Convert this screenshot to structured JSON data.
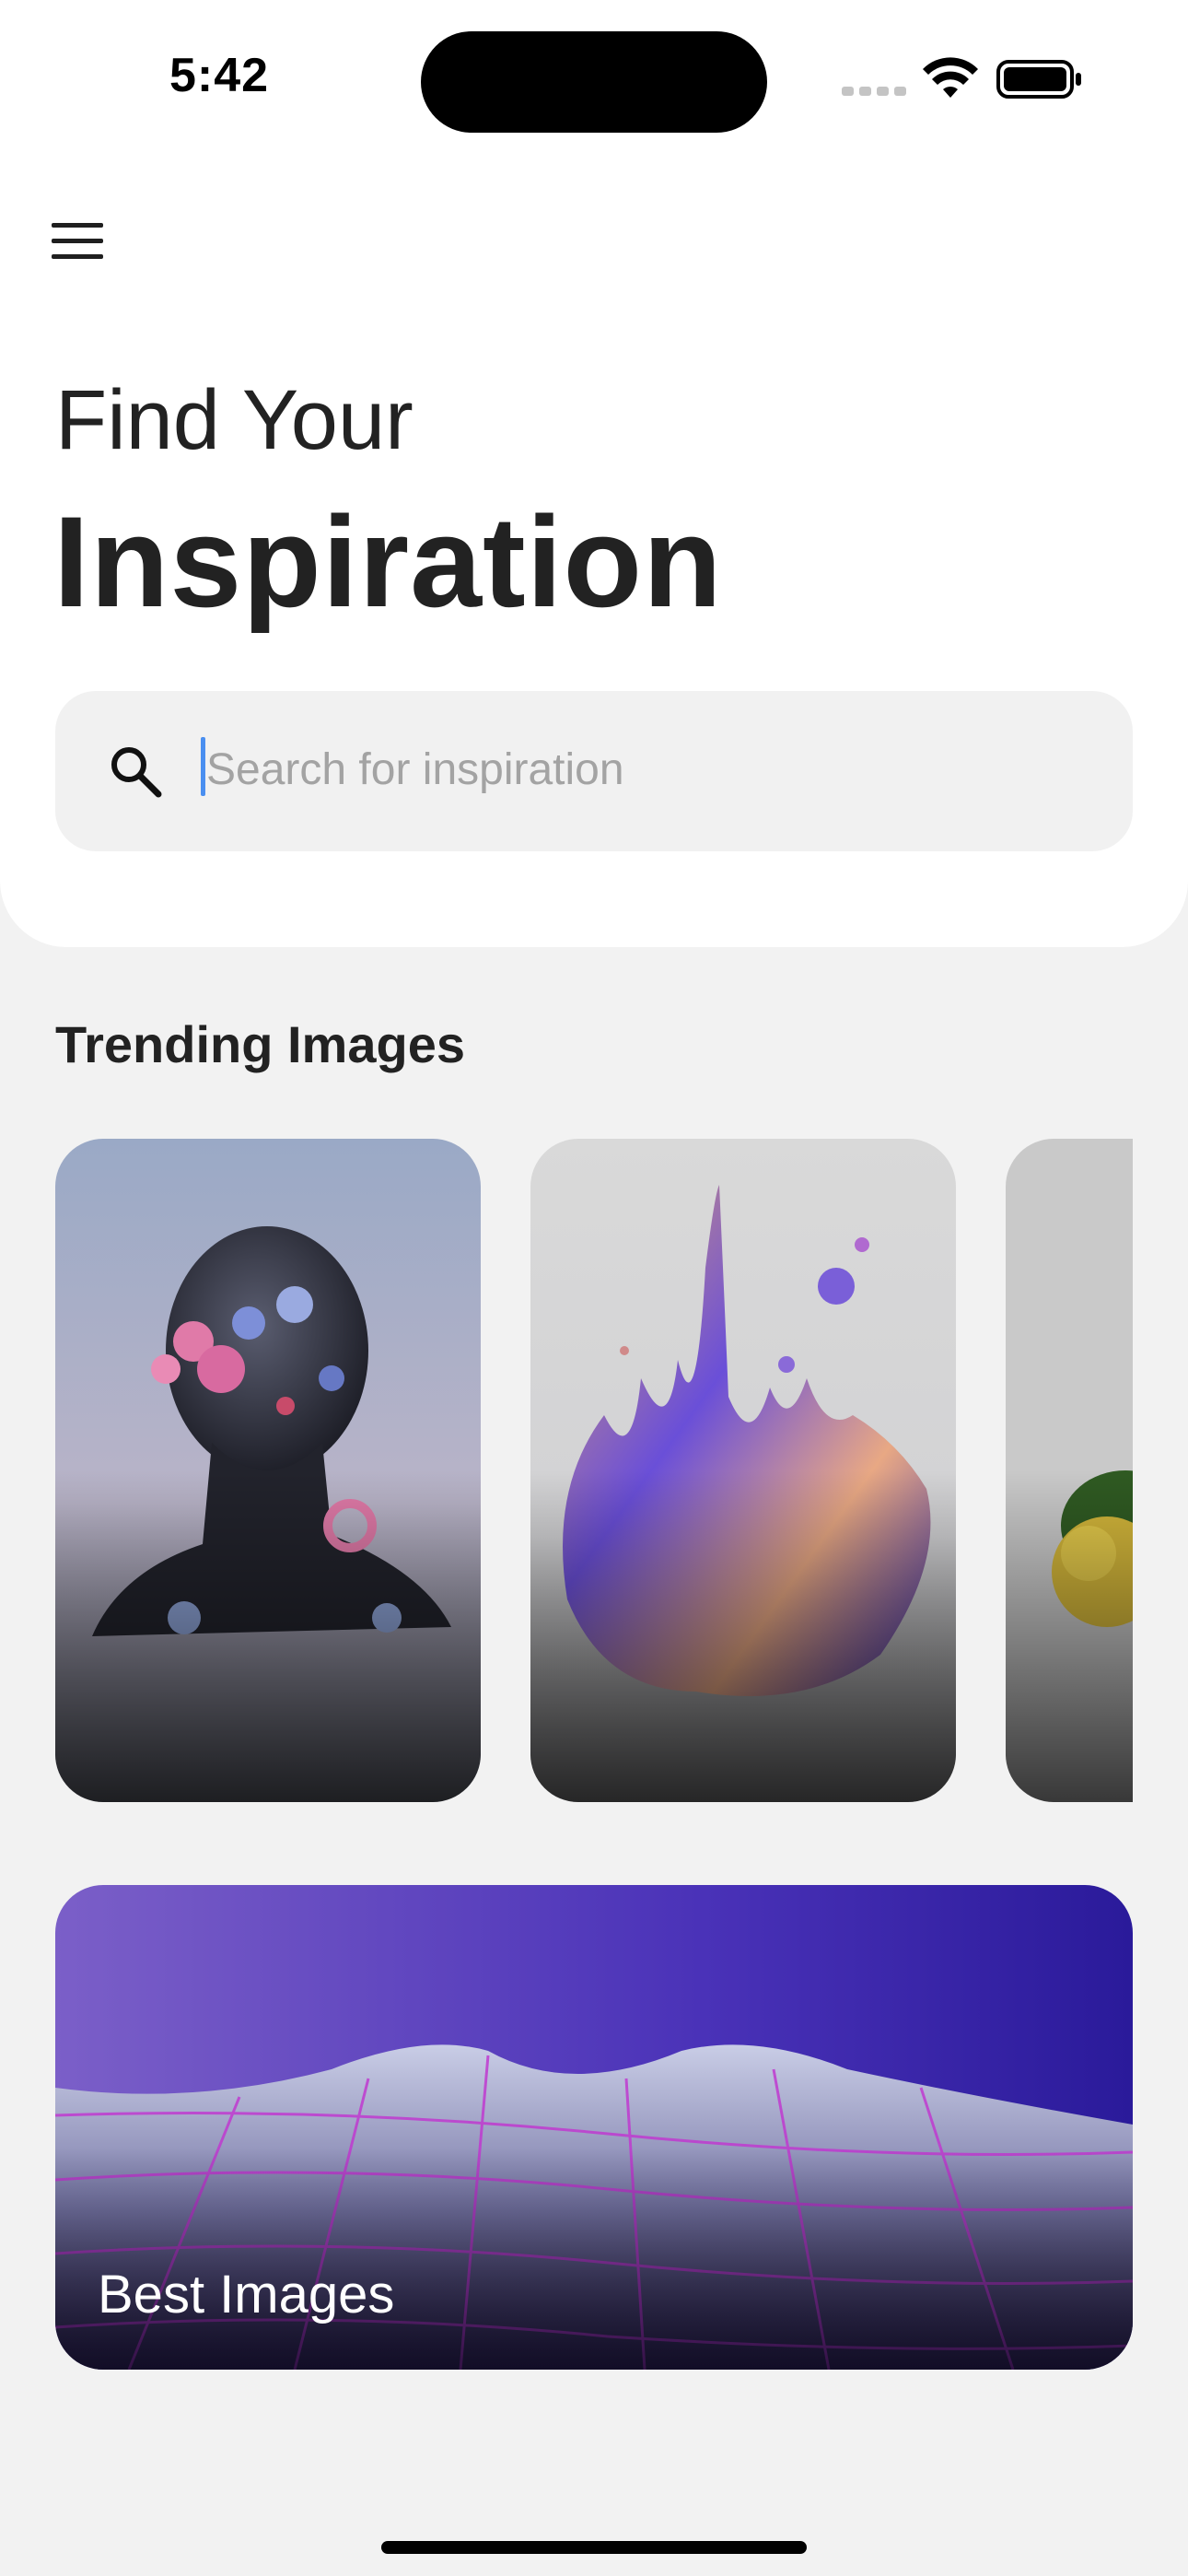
{
  "status_bar": {
    "time": "5:42"
  },
  "header": {
    "menu_icon": "hamburger-menu-icon",
    "title_line1": "Find Your",
    "title_line2": "Inspiration"
  },
  "search": {
    "icon": "search-icon",
    "placeholder": "Search for inspiration",
    "value": ""
  },
  "trending": {
    "title": "Trending Images",
    "items": [
      {
        "subject": "sculpted head with flowers"
      },
      {
        "subject": "iridescent liquid splash"
      },
      {
        "subject": "yellow rose"
      }
    ]
  },
  "best": {
    "label": "Best Images"
  },
  "colors": {
    "background": "#f2f2f2",
    "panel": "#ffffff",
    "text": "#222222",
    "accent_caret": "#4a8ff0",
    "best_purple": "#3a1fa8"
  }
}
